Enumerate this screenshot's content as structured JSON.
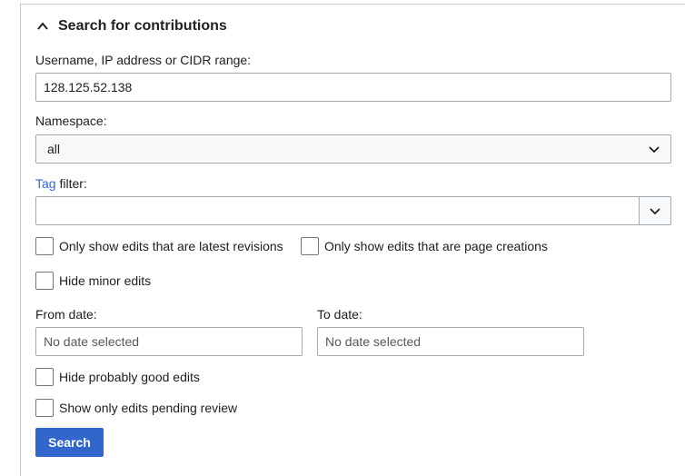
{
  "header": {
    "title": "Search for contributions",
    "toggle_icon": "chevron-up-icon"
  },
  "username": {
    "label": "Username, IP address or CIDR range:",
    "value": "128.125.52.138"
  },
  "namespace": {
    "label": "Namespace:",
    "selected": "all",
    "icon": "chevron-down-icon"
  },
  "tag_filter": {
    "link_label": "Tag",
    "label_suffix": " filter:",
    "value": "",
    "icon": "chevron-down-icon"
  },
  "options": {
    "latest_revisions": {
      "label": "Only show edits that are latest revisions",
      "checked": false
    },
    "page_creations": {
      "label": "Only show edits that are page creations",
      "checked": false
    },
    "hide_minor": {
      "label": "Hide minor edits",
      "checked": false
    }
  },
  "from_date": {
    "label": "From date:",
    "placeholder": "No date selected"
  },
  "to_date": {
    "label": "To date:",
    "placeholder": "No date selected"
  },
  "filters": {
    "hide_good": {
      "label": "Hide probably good edits",
      "checked": false
    },
    "pending_review": {
      "label": "Show only edits pending review",
      "checked": false
    }
  },
  "search_button": {
    "label": "Search"
  },
  "colors": {
    "accent": "#3366cc",
    "border": "#a2a9b1",
    "text": "#202122"
  }
}
